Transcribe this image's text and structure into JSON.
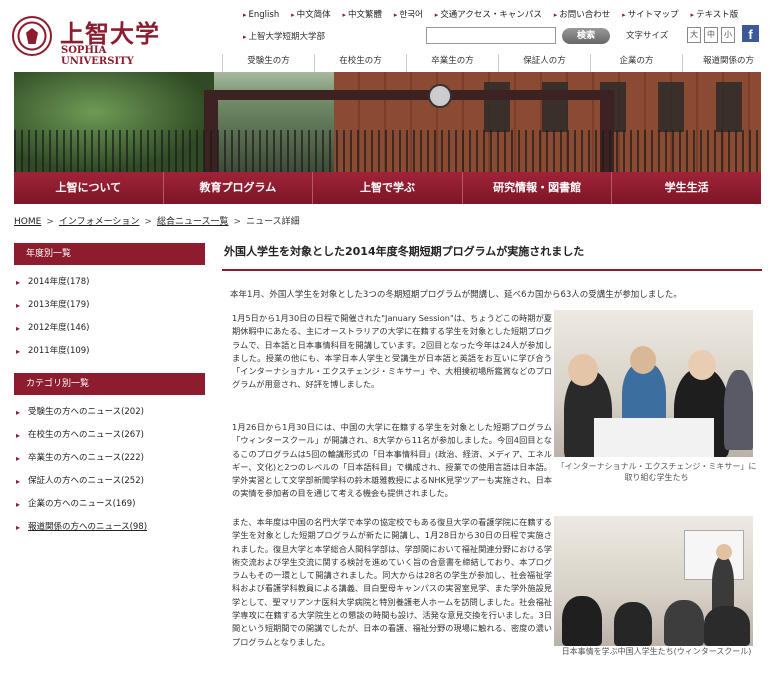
{
  "header": {
    "logo_ja": "上智大学",
    "logo_en": "SOPHIA UNIVERSITY",
    "util_links": [
      "English",
      "中文简体",
      "中文繁體",
      "한국어",
      "交通アクセス・キャンパス",
      "お問い合わせ",
      "サイトマップ",
      "テキスト版"
    ],
    "util_link_junior": "上智大学短期大学部",
    "search_button": "検索",
    "fontsize_label": "文字サイズ",
    "fontsize_large": "大",
    "fontsize_mid": "中",
    "fontsize_small": "小",
    "facebook": "f",
    "audience_nav": [
      "受験生の方",
      "在校生の方",
      "卒業生の方",
      "保証人の方",
      "企業の方",
      "報道関係の方"
    ]
  },
  "main_nav": [
    "上智について",
    "教育プログラム",
    "上智で学ぶ",
    "研究情報・図書館",
    "学生生活"
  ],
  "breadcrumb": [
    "HOME",
    "インフォメーション",
    "総合ニュース一覧",
    "ニュース詳細"
  ],
  "sidebar": {
    "year_heading": "年度別一覧",
    "years": [
      "2014年度(178)",
      "2013年度(179)",
      "2012年度(146)",
      "2011年度(109)"
    ],
    "category_heading": "カテゴリ別一覧",
    "categories": [
      "受験生の方へのニュース(202)",
      "在校生の方へのニュース(267)",
      "卒業生の方へのニュース(222)",
      "保証人の方へのニュース(252)",
      "企業の方へのニュース(169)",
      "報道関係の方へのニュース(98)"
    ]
  },
  "article": {
    "title": "外国人学生を対象とした2014年度冬期短期プログラムが実施されました",
    "lead": "本年1月、外国人学生を対象とした3つの冬期短期プログラムが開講し、延べ6カ国から63人の受講生が参加しました。",
    "para1": "1月5日から1月30日の日程で開催された\"January Session\"は、ちょうどこの時期が夏期休暇中にあたる、主にオーストラリアの大学に在籍する学生を対象とした短期プログラムで、日本語と日本事情科目を開講しています。2回目となった今年は24人が参加しました。授業の他にも、本学日本人学生と受講生が日本語と英語をお互いに学び合う「インターナショナル・エクスチェンジ・ミキサー」や、大相撲初場所鑑賞などのプログラムが用意され、好評を博しました。",
    "para2": "1月26日から1月30日には、中国の大学に在籍する学生を対象とした短期プログラム「ウィンタースクール」が開講され、8大学から11名が参加しました。今回4回目となるこのプログラムは5回の輪講形式の「日本事情科目」(政治、経済、メディア、エネルギー、文化)と2つのレベルの「日本語科目」で構成され、授業での使用言語は日本語。学外実習として文学部新聞学科の鈴木雄雅教授によるNHK見学ツアーも実施され、日本の実情を参加者の目を通じて考える機会も提供されました。",
    "para3": "また、本年度は中国の名門大学で本学の協定校でもある復旦大学の看護学院に在籍する学生を対象とした短期プログラムが新たに開講し、1月28日から30日の日程で実施されました。復旦大学と本学総合人間科学部は、学部間において福祉関連分野における学術交流および学生交流に関する検討を進めていく旨の合意書を締結しており、本プログラムもその一環として開講されました。同大からは28名の学生が参加し、社会福祉学科および看護学科教員による講義、目白聖母キャンパスの実習室見学、また学外施設見学として、聖マリアンナ医科大学病院と特別養護老人ホームを訪問しました。社会福祉学専攻に在籍する大学院生との懇談の時間も設け、活発な意見交換を行いました。3日間という短期間での開講でしたが、日本の看護、福祉分野の現場に触れる、密度の濃いプログラムとなりました。",
    "caption1": "「インターナショナル・エクスチェンジ・ミキサー」に取り組む学生たち",
    "caption2": "日本事情を学ぶ中国人学生たち(ウィンタースクール)"
  },
  "colors": {
    "brand": "#8d1c2e",
    "link_arrow": "#8d1c2e"
  }
}
